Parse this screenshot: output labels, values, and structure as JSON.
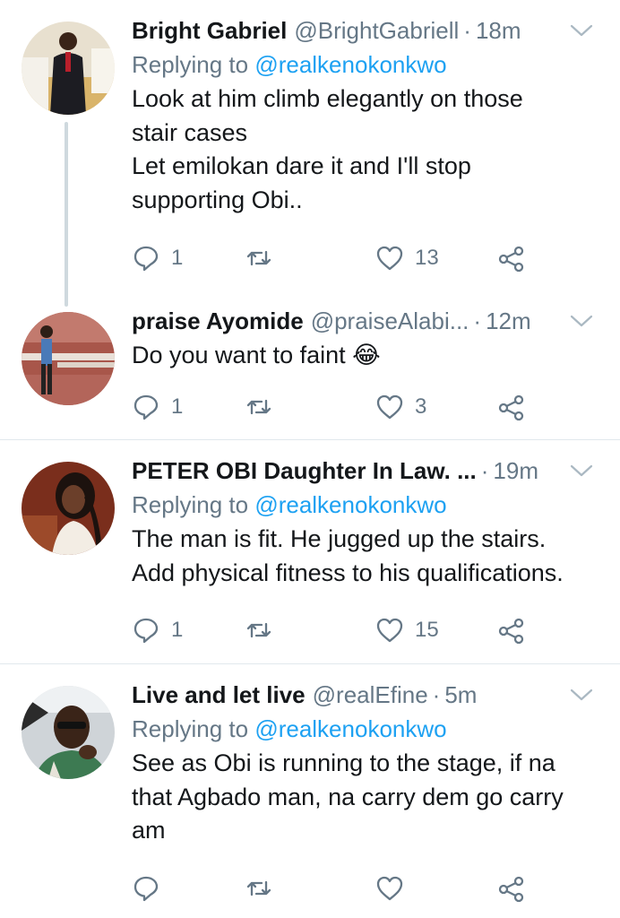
{
  "tweets": [
    {
      "name": "Bright Gabriel",
      "handle": "@BrightGabriell",
      "dot": "·",
      "time": "18m",
      "replying_prefix": "Replying to",
      "replying_handle": "@realkenokonkwo",
      "lines": [
        "Look at him climb elegantly on those",
        "stair cases",
        "Let emilokan dare it and I'll stop",
        "supporting Obi.."
      ],
      "reply_count": "1",
      "retweet_count": "",
      "like_count": "13"
    },
    {
      "name": "praise Ayomide",
      "handle": "@praiseAlabi...",
      "dot": "·",
      "time": "12m",
      "lines": [
        "Do you want to faint 😂"
      ],
      "reply_count": "1",
      "retweet_count": "",
      "like_count": "3"
    },
    {
      "name": "PETER OBI Daughter In Law. ...",
      "handle": "",
      "dot": "·",
      "time": "19m",
      "replying_prefix": "Replying to",
      "replying_handle": "@realkenokonkwo",
      "lines": [
        "The man is fit. He jugged up the stairs.",
        "Add physical fitness to his qualifications."
      ],
      "reply_count": "1",
      "retweet_count": "",
      "like_count": "15"
    },
    {
      "name": "Live and let live",
      "handle": "@realEfine",
      "dot": "·",
      "time": "5m",
      "replying_prefix": "Replying to",
      "replying_handle": "@realkenokonkwo",
      "lines": [
        "See as Obi is running to the stage, if na",
        "that Agbado man, na carry dem go carry",
        "am"
      ],
      "reply_count": "",
      "retweet_count": "",
      "like_count": ""
    }
  ],
  "colors": {
    "text": "#14171a",
    "secondary": "#657786",
    "link": "#1da1f2",
    "divider": "#e1e8ed",
    "thread": "#cfd9de"
  },
  "icons": [
    "reply-icon",
    "retweet-icon",
    "like-icon",
    "share-icon",
    "chevron-down-icon"
  ]
}
